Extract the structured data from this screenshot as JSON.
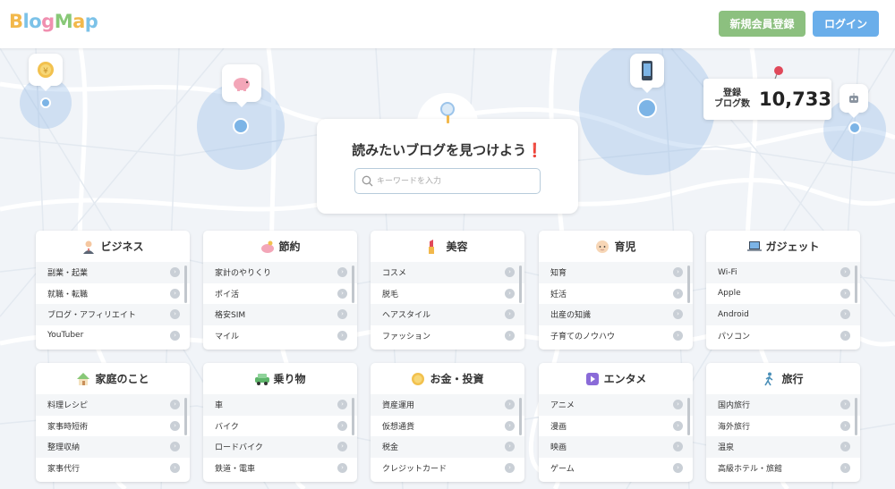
{
  "header": {
    "logo": [
      "B",
      "lo",
      "g",
      "M",
      "a",
      "p"
    ],
    "register_label": "新規会員登録",
    "login_label": "ログイン"
  },
  "count": {
    "label_line1": "登録",
    "label_line2": "ブログ数",
    "value": "10,733"
  },
  "search": {
    "title": "読みたいブログを見つけよう",
    "title_mark": "❗",
    "placeholder": "キーワードを入力"
  },
  "categories": [
    {
      "name": "ビジネス",
      "icon": "businessman-icon",
      "items": [
        "副業・起業",
        "就職・転職",
        "ブログ・アフィリエイト",
        "YouTuber"
      ]
    },
    {
      "name": "節約",
      "icon": "piggy-bank-icon",
      "items": [
        "家計のやりくり",
        "ポイ活",
        "格安SIM",
        "マイル"
      ]
    },
    {
      "name": "美容",
      "icon": "lipstick-icon",
      "items": [
        "コスメ",
        "脱毛",
        "ヘアスタイル",
        "ファッション"
      ]
    },
    {
      "name": "育児",
      "icon": "baby-icon",
      "items": [
        "知育",
        "妊活",
        "出産の知識",
        "子育てのノウハウ"
      ]
    },
    {
      "name": "ガジェット",
      "icon": "laptop-icon",
      "items": [
        "Wi-Fi",
        "Apple",
        "Android",
        "パソコン"
      ]
    },
    {
      "name": "家庭のこと",
      "icon": "house-icon",
      "items": [
        "料理レシピ",
        "家事時短術",
        "整理収納",
        "家事代行"
      ]
    },
    {
      "name": "乗り物",
      "icon": "car-icon",
      "items": [
        "車",
        "バイク",
        "ロードバイク",
        "鉄道・電車"
      ]
    },
    {
      "name": "お金・投資",
      "icon": "coin-icon",
      "items": [
        "資産運用",
        "仮想通貨",
        "税金",
        "クレジットカード"
      ]
    },
    {
      "name": "エンタメ",
      "icon": "play-icon",
      "items": [
        "アニメ",
        "漫画",
        "映画",
        "ゲーム"
      ]
    },
    {
      "name": "旅行",
      "icon": "walker-icon",
      "items": [
        "国内旅行",
        "海外旅行",
        "温泉",
        "高級ホテル・旅館"
      ]
    }
  ],
  "colors": {
    "register": "#8cc07f",
    "login": "#6aaeea",
    "accent": "#7cb4e6"
  }
}
